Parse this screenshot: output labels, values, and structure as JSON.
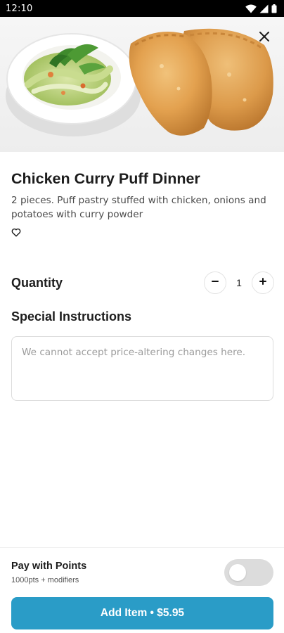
{
  "status_bar": {
    "time": "12:10",
    "icons": [
      "wifi-icon",
      "signal-icon",
      "battery-icon"
    ]
  },
  "hero": {
    "image": "chicken-curry-puff-photo",
    "close_icon": "close-icon"
  },
  "item": {
    "title": "Chicken Curry Puff Dinner",
    "description": "2 pieces. Puff pastry stuffed with chicken, onions and potatoes with curry powder",
    "favorite_icon": "heart-outline-icon"
  },
  "quantity": {
    "label": "Quantity",
    "value": "1",
    "decrement_icon": "minus-icon",
    "increment_icon": "plus-icon"
  },
  "special_instructions": {
    "label": "Special Instructions",
    "placeholder": "We cannot accept price-altering changes here.",
    "value": ""
  },
  "footer": {
    "points_title": "Pay with Points",
    "points_subtitle": "1000pts + modifiers",
    "points_toggle_on": false,
    "add_button_label": "Add Item • $5.95"
  },
  "colors": {
    "accent": "#2a9cc7",
    "toggle_off": "#dcdcdc",
    "text": "#1d1d1d",
    "muted": "#4a4a4a"
  }
}
